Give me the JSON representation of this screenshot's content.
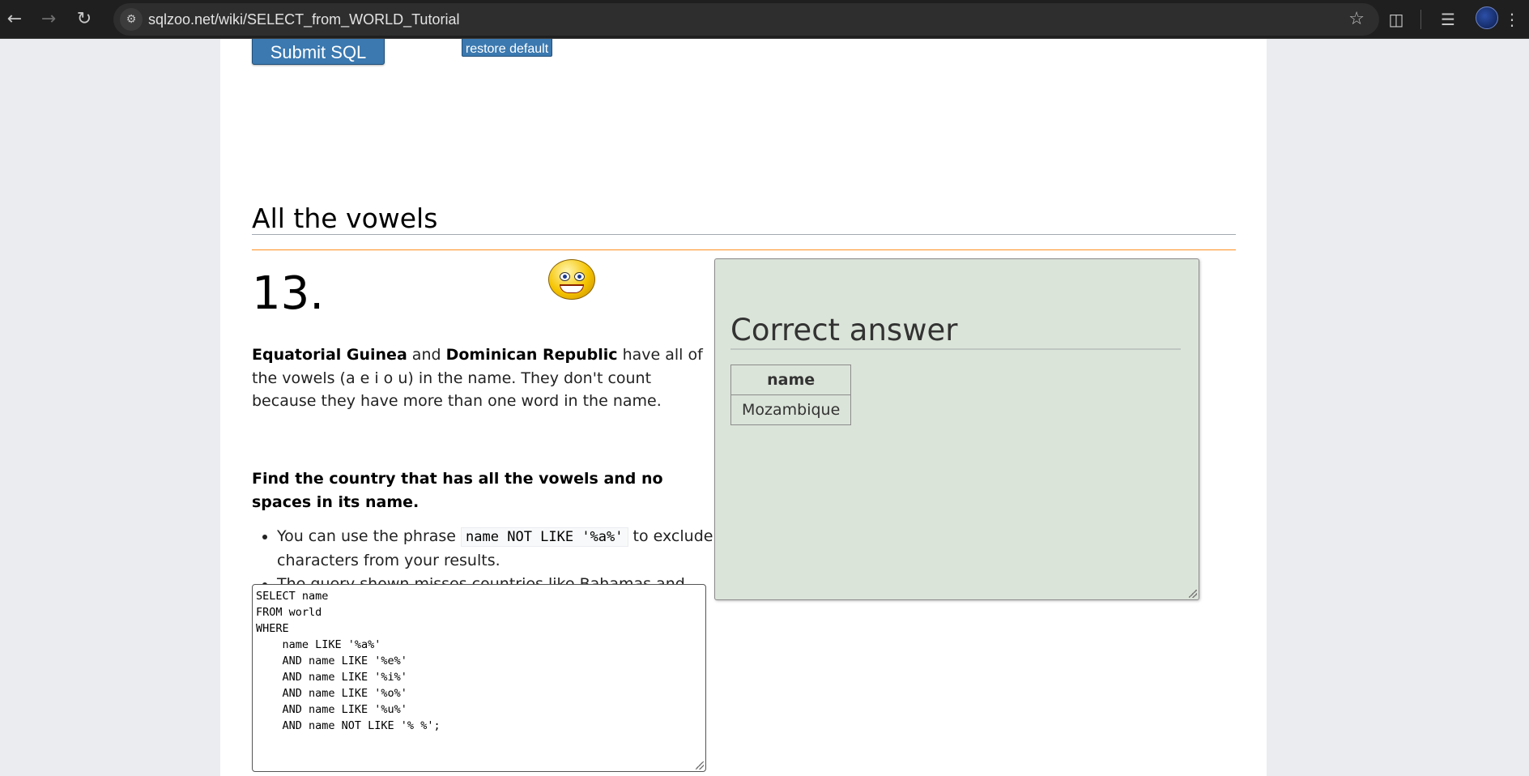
{
  "browser": {
    "url": "sqlzoo.net/wiki/SELECT_from_WORLD_Tutorial"
  },
  "toolbar": {
    "submit_label": "Submit SQL",
    "restore_label": "restore default"
  },
  "section": {
    "heading": "All the vowels"
  },
  "question": {
    "number": "13.",
    "intro_bold_1": "Equatorial Guinea",
    "intro_and": " and ",
    "intro_bold_2": "Dominican Republic",
    "intro_rest": " have all of the vowels (a e i o u) in the name. They don't count because they have more than one word in the name.",
    "task": "Find the country that has all the vowels and no spaces in its name.",
    "hints": [
      {
        "before": "You can use the phrase ",
        "code": "name NOT LIKE '%a%'",
        "after": " to exclude characters from your results."
      },
      {
        "text": "The query shown misses countries like Bahamas and Belarus because they contain at least one 'a'"
      }
    ]
  },
  "sql": {
    "query": "SELECT name\nFROM world\nWHERE\n    name LIKE '%a%'\n    AND name LIKE '%e%'\n    AND name LIKE '%i%'\n    AND name LIKE '%o%'\n    AND name LIKE '%u%'\n    AND name NOT LIKE '% %';"
  },
  "answer": {
    "title": "Correct answer",
    "column": "name",
    "rows": [
      "Mozambique"
    ]
  }
}
